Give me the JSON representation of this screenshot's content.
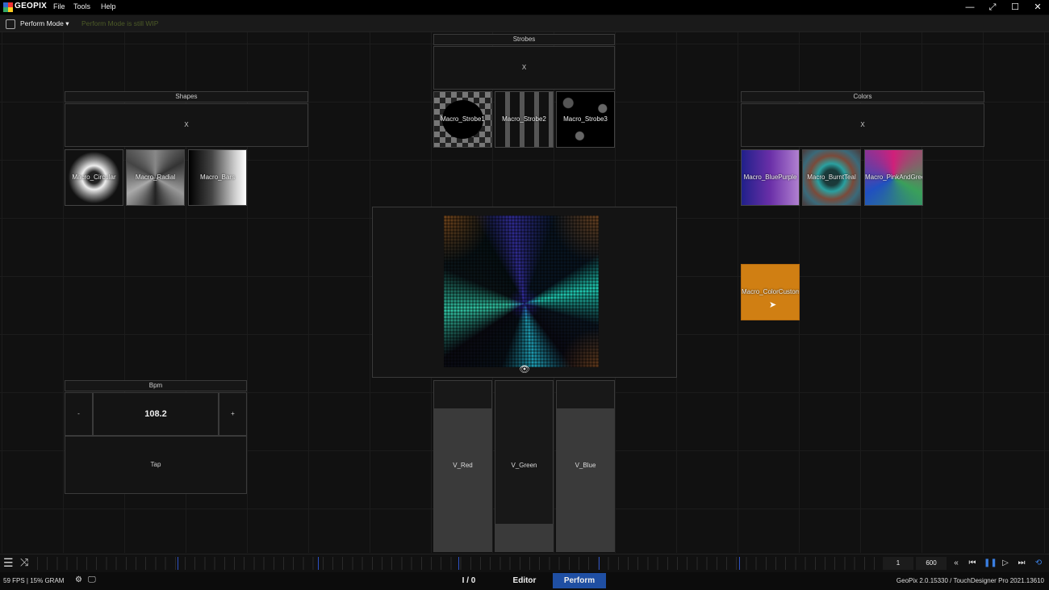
{
  "window": {
    "title": "GEOPIX",
    "menu": [
      "File",
      "Tools",
      "Help"
    ],
    "controls": {
      "minimize": "—",
      "restore": "⤢",
      "maximize": "☐",
      "close": "✕"
    }
  },
  "modebar": {
    "mode": "Perform Mode",
    "note": "Perform Mode is still WIP"
  },
  "strobes": {
    "header": "Strobes",
    "clear": "X",
    "macros": [
      "Macro_Strobe1",
      "Macro_Strobe2",
      "Macro_Strobe3"
    ]
  },
  "shapes": {
    "header": "Shapes",
    "clear": "X",
    "macros": [
      "Macro_Circular",
      "Macro_Radial",
      "Macro_Bars"
    ]
  },
  "colors": {
    "header": "Colors",
    "clear": "X",
    "macros": [
      "Macro_BluePurple",
      "Macro_BurntTeal",
      "Macro_PinkAndGreen"
    ],
    "custom": "Macro_ColorCustom",
    "custom_color": "#d07f13"
  },
  "bpm": {
    "header": "Bpm",
    "minus": "-",
    "value": "108.2",
    "plus": "+",
    "tap": "Tap"
  },
  "faders": [
    {
      "label": "V_Red",
      "level": 0.84
    },
    {
      "label": "V_Green",
      "level": 0.16
    },
    {
      "label": "V_Blue",
      "level": 0.84
    }
  ],
  "timeline": {
    "start": "1",
    "end": "600"
  },
  "status": {
    "fps": "59 FPS | 15% GRAM",
    "io": "I / 0",
    "editor": "Editor",
    "perform": "Perform",
    "version": "GeoPix 2.0.15330 / TouchDesigner Pro 2021.13610"
  },
  "accent": "#1f4fa3"
}
